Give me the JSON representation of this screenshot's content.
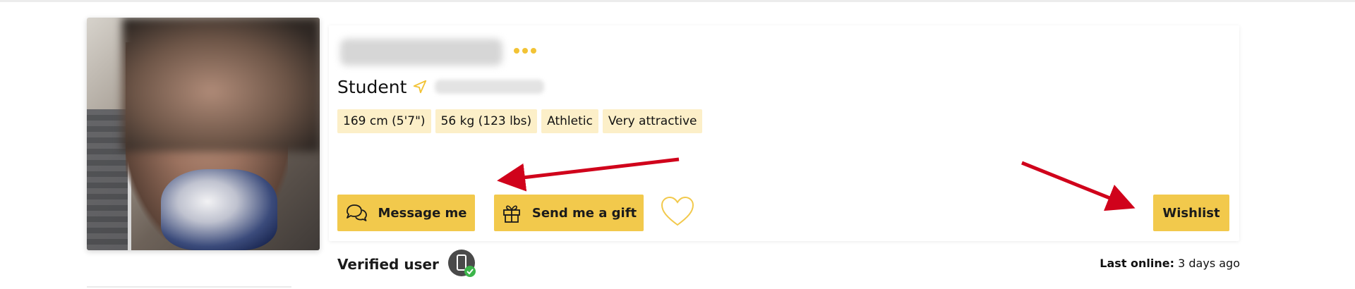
{
  "profile": {
    "occupation": "Student",
    "tags": [
      "169 cm (5'7\")",
      "56 kg (123 lbs)",
      "Athletic",
      "Very attractive"
    ]
  },
  "actions": {
    "message_label": "Message me",
    "gift_label": "Send me a gift",
    "wishlist_label": "Wishlist"
  },
  "status": {
    "verified_label": "Verified user",
    "last_online_label": "Last online:",
    "last_online_value": "3 days ago"
  },
  "icons": {
    "more": "more-dots-icon",
    "location": "location-arrow-icon",
    "message": "chat-bubbles-icon",
    "gift": "gift-icon",
    "favorite": "heart-outline-icon",
    "verified_phone": "verified-phone-icon"
  },
  "colors": {
    "accent": "#f2c94c",
    "tag_bg": "#fcefc8",
    "annotation_arrow": "#d0021b",
    "verified_check": "#3cb54a"
  }
}
